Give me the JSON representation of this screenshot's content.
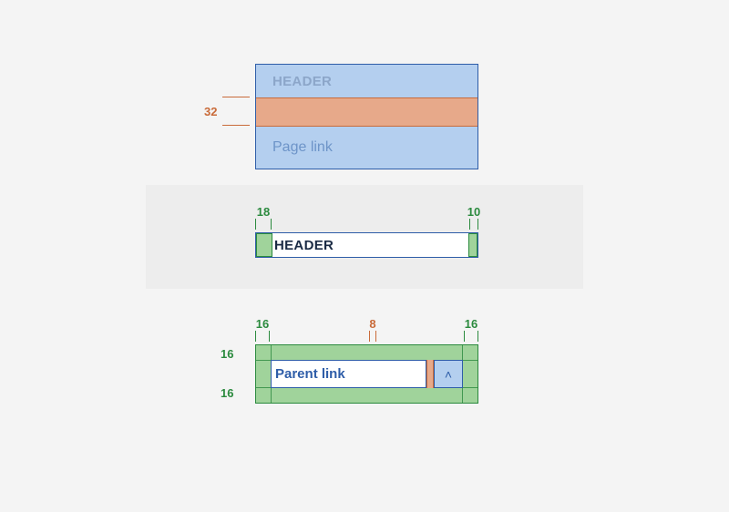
{
  "example1": {
    "header_label": "HEADER",
    "gap_value": "32",
    "link_label": "Page link"
  },
  "example2": {
    "header_label": "HEADER",
    "pad_left_value": "18",
    "pad_right_value": "10"
  },
  "example3": {
    "link_label": "Parent link",
    "chevron_glyph": "˄",
    "pad_left_value": "16",
    "pad_right_value": "16",
    "gap_value": "8",
    "pad_top_value": "16",
    "pad_bottom_value": "16"
  },
  "colors": {
    "blue_fill": "#b4cfef",
    "blue_stroke": "#2e5da8",
    "green_fill": "#a0d39b",
    "green_stroke": "#2b8a3e",
    "orange_fill": "#e7a98a",
    "orange_stroke": "#c96b3a"
  }
}
